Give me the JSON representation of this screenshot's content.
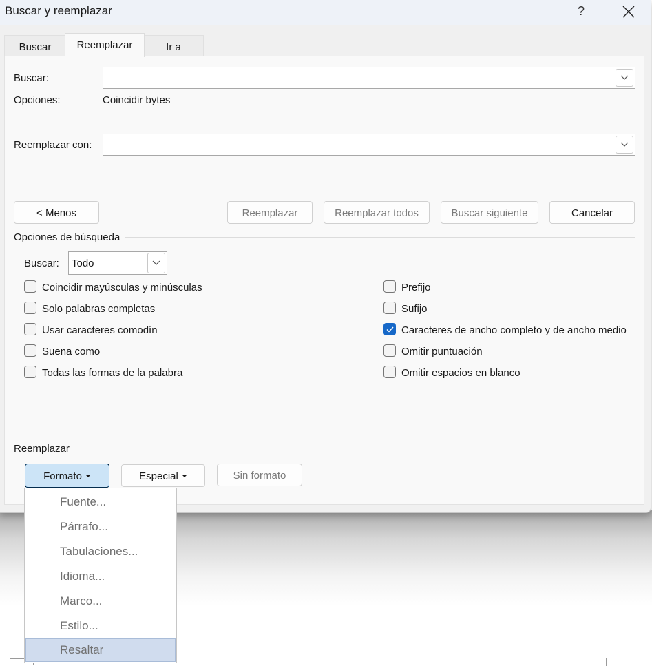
{
  "dialog": {
    "title": "Buscar y reemplazar",
    "help_label": "?",
    "close_icon": "close-icon"
  },
  "tabs": [
    {
      "label": "Buscar",
      "accesskey": "B",
      "active": false
    },
    {
      "label": "Reemplazar",
      "accesskey": "z",
      "active": true
    },
    {
      "label": "Ir a",
      "accesskey": "I",
      "active": false
    }
  ],
  "find": {
    "label": "Buscar:",
    "value": "",
    "options_label": "Opciones:",
    "options_value": "Coincidir bytes"
  },
  "replace": {
    "label": "Reemplazar con:",
    "value": ""
  },
  "buttons": {
    "less": "< Menos",
    "less_prefix": "<",
    "replace": "Reemplazar",
    "replace_all": "Reemplazar todos",
    "find_next": "Buscar siguiente",
    "cancel": "Cancelar"
  },
  "search_options": {
    "group_label": "Opciones de búsqueda",
    "search_label": "Buscar:",
    "search_value": "Todo",
    "left_checks": [
      {
        "label": "Coincidir mayúsculas y minúsculas",
        "checked": false
      },
      {
        "label": "Solo palabras completas",
        "checked": false
      },
      {
        "label": "Usar caracteres comodín",
        "checked": false
      },
      {
        "label": "Suena como",
        "checked": false
      },
      {
        "label": "Todas las formas de la palabra",
        "checked": false
      }
    ],
    "right_checks": [
      {
        "label": "Prefijo",
        "checked": false
      },
      {
        "label": "Sufijo",
        "checked": false
      },
      {
        "label": "Caracteres de ancho completo y de ancho medio",
        "checked": true
      },
      {
        "label": "Omitir puntuación",
        "checked": false
      },
      {
        "label": "Omitir espacios en blanco",
        "checked": false
      }
    ]
  },
  "replace_group": {
    "label": "Reemplazar",
    "format_button": "Formato",
    "special_button": "Especial",
    "no_format_button": "Sin formato"
  },
  "format_menu": {
    "items": [
      {
        "label": "Fuente...",
        "highlighted": false
      },
      {
        "label": "Párrafo...",
        "highlighted": false
      },
      {
        "label": "Tabulaciones...",
        "highlighted": false
      },
      {
        "label": "Idioma...",
        "highlighted": false
      },
      {
        "label": "Marco...",
        "highlighted": false
      },
      {
        "label": "Estilo...",
        "highlighted": false
      },
      {
        "label": "Resaltar",
        "highlighted": true
      }
    ]
  },
  "colors": {
    "accent": "#1668c8",
    "format_button_bg": "#cce4f7",
    "menu_highlight": "#d0dcee"
  }
}
